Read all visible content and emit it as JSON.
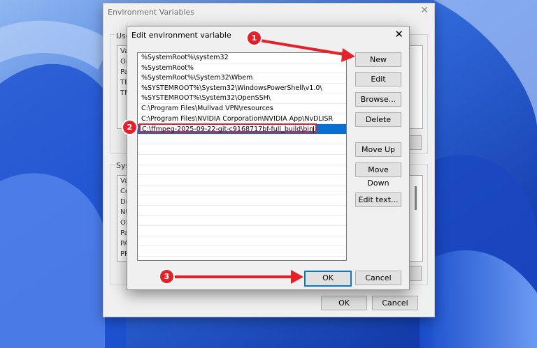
{
  "background_window": {
    "title": "Environment Variables",
    "user_label_partial": "User",
    "system_label_partial": "Syste",
    "user_rows_partial": [
      "Va",
      "On",
      "Pa",
      "TE",
      "TM"
    ],
    "system_rows_partial": [
      "Va",
      "Co",
      "Dr",
      "NU",
      "OS",
      "Pa",
      "PA",
      "PR"
    ],
    "ok_label": "OK",
    "cancel_label": "Cancel"
  },
  "dialog": {
    "title": "Edit environment variable",
    "entries": [
      "%SystemRoot%\\system32",
      "%SystemRoot%",
      "%SystemRoot%\\System32\\Wbem",
      "%SYSTEMROOT%\\System32\\WindowsPowerShell\\v1.0\\",
      "%SYSTEMROOT%\\System32\\OpenSSH\\",
      "C:\\Program Files\\Mullvad VPN\\resources",
      "C:\\Program Files\\NVIDIA Corporation\\NVIDIA App\\NvDLISR"
    ],
    "editing_entry": "C:\\ffmpeg-2025-09-22-git-c9168717bf-full_build\\bin",
    "buttons": {
      "new": "New",
      "edit": "Edit",
      "browse": "Browse...",
      "delete": "Delete",
      "move_up": "Move Up",
      "move_down": "Move Down",
      "edit_text": "Edit text...",
      "ok": "OK",
      "cancel": "Cancel"
    }
  },
  "annotations": {
    "step1": "1",
    "step2": "2",
    "step3": "3",
    "color": "#e3212b"
  },
  "colors": {
    "selection": "#0a6fd3",
    "default_button_border": "#0078d7"
  }
}
